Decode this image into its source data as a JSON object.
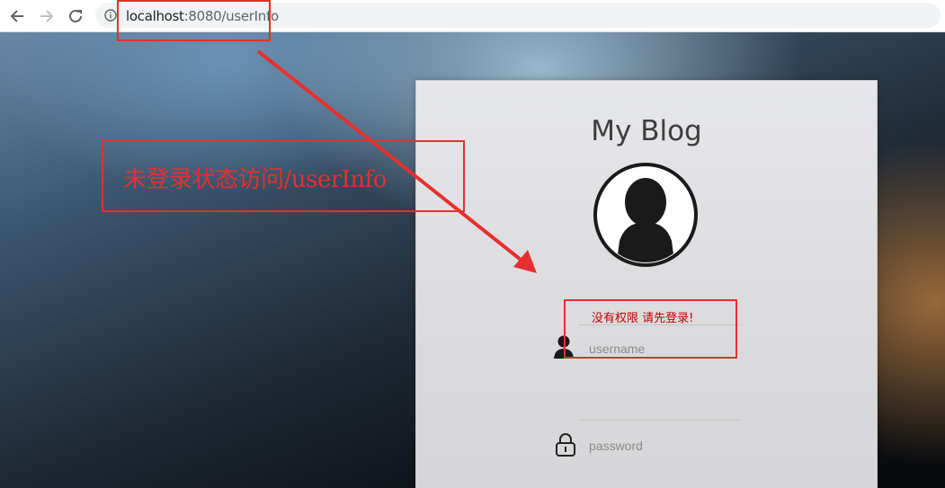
{
  "browser": {
    "back_icon": "arrow-left-icon",
    "forward_icon": "arrow-right-icon",
    "reload_icon": "reload-icon",
    "info_icon": "info-icon",
    "url_host": "localhost",
    "url_rest": ":8080/userInfo"
  },
  "login": {
    "title": "My Blog",
    "avatar_icon": "user-silhouette-icon",
    "error": "没有权限 请先登录!",
    "username_placeholder": "username",
    "password_placeholder": "password",
    "username_icon": "user-icon",
    "password_icon": "lock-icon"
  },
  "annotation": {
    "text": "未登录状态访问/userInfo",
    "color": "#e5302f"
  }
}
